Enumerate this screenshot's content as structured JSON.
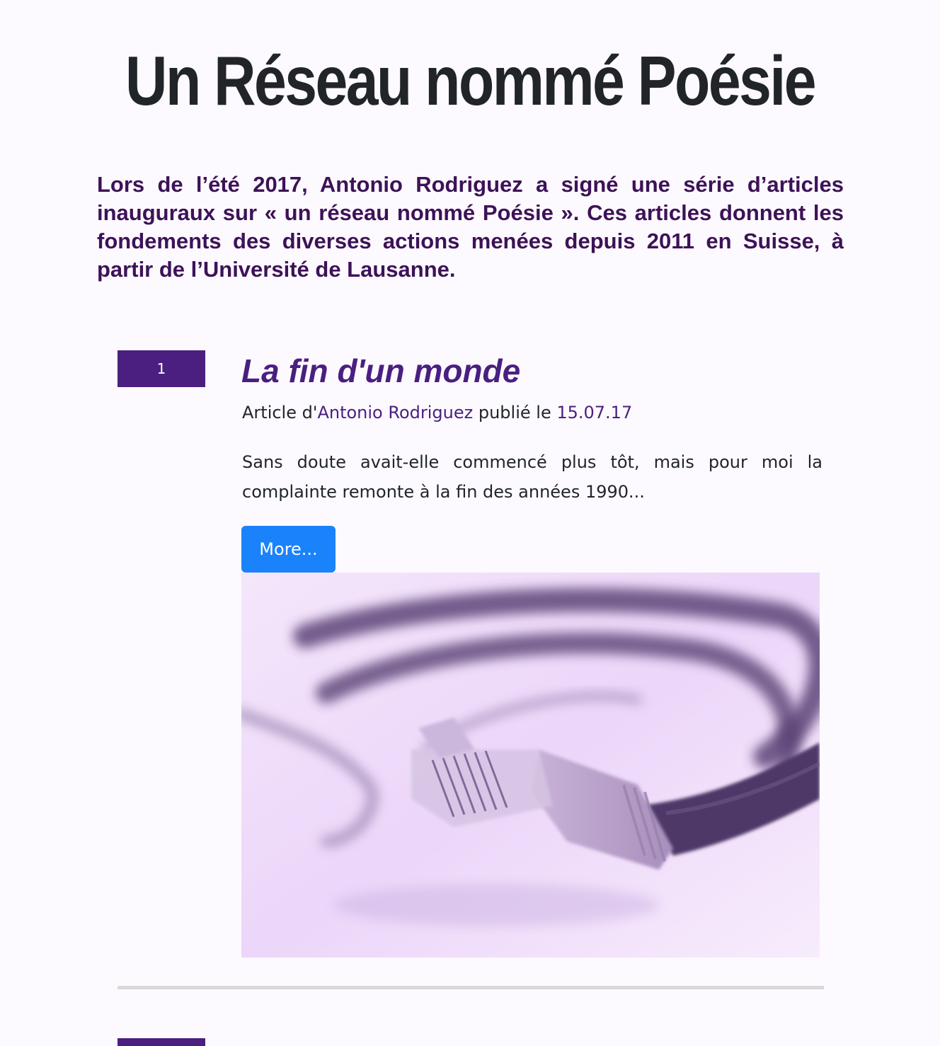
{
  "site": {
    "title": "Un Réseau nommé Poésie"
  },
  "intro": {
    "text": "Lors de l’été 2017, Antonio Rodriguez a signé une série d’articles inauguraux sur « un réseau nommé Poésie ». Ces articles donnent les fondements des diverses actions menées depuis 2011 en Suisse, à partir de l’Université de Lausanne."
  },
  "articles": [
    {
      "number": "1",
      "title": "La fin d'un monde",
      "byline_prefix": "Article d'",
      "author": "Antonio Rodriguez",
      "byline_middle": " publié le ",
      "date": "15.07.17",
      "excerpt": "Sans doute avait-elle commencé plus tôt, mais pour moi la complainte remonte à la fin des années 1990...",
      "more_label": "More...",
      "image_subject": "network-cable-photo"
    }
  ],
  "colors": {
    "accent": "#4a1f80",
    "intro_text": "#3d1257",
    "button": "#1a82fb",
    "background": "#fdfaff",
    "divider": "#d9d9dc"
  }
}
